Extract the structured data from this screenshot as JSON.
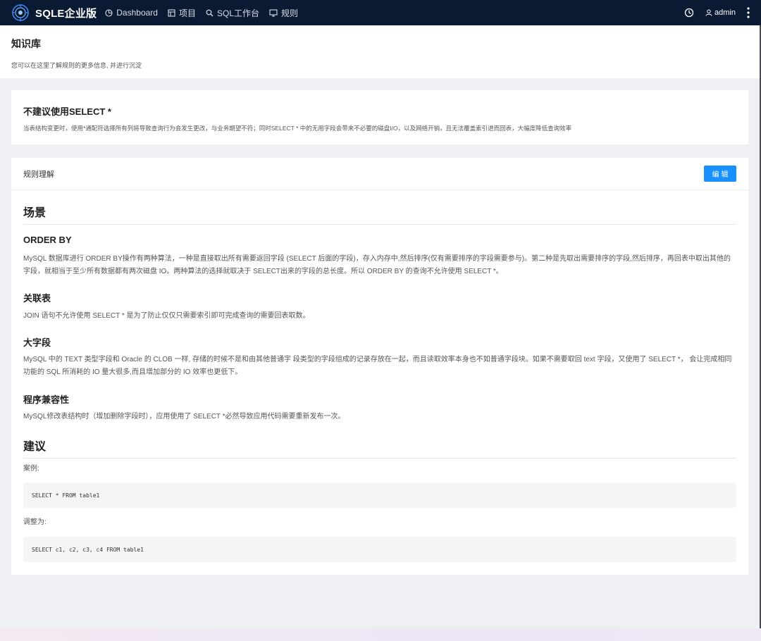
{
  "app": {
    "logo_text": "SQLE企业版",
    "nav": [
      {
        "label": "Dashboard",
        "icon": "dashboard-icon"
      },
      {
        "label": "项目",
        "icon": "project-icon"
      },
      {
        "label": "SQL工作台",
        "icon": "search-icon"
      },
      {
        "label": "规则",
        "icon": "monitor-icon"
      }
    ],
    "user": "admin"
  },
  "page": {
    "title": "知识库",
    "subtitle": "您可以在这里了解规则的更多信息, 并进行沉淀"
  },
  "rule": {
    "title": "不建议使用SELECT *",
    "description": "当表结构变更时，使用*通配符选择所有列将导致查询行为会发生更改，与业务期望不符；同时SELECT * 中的无用字段会带来不必要的磁盘I/O，以及网络开销，且无法覆盖索引进而回表，大幅度降低查询效率"
  },
  "detail": {
    "header_label": "规则理解",
    "edit_label": "编辑",
    "scene_heading": "场景",
    "sections": [
      {
        "heading": "ORDER BY",
        "text": "MySQL 数据库进行 ORDER BY操作有两种算法，一种是直接取出所有需要返回字段 (SELECT 后面的字段)，存入内存中,然后排序(仅有需要排序的字段需要参与)。第二种是先取出需要排序的字段,然后排序，再回表中取出其他的字段，就相当于至少所有数据都有两次磁盘 IO。两种算法的选择就取决于 SELECT出来的字段的总长度。所以 ORDER BY 的查询不允许使用 SELECT *。"
      },
      {
        "heading": "关联表",
        "text": "JOIN 语句不允许使用 SELECT * 是为了防止仅仅只需要索引即可完成查询的需要回表取数。"
      },
      {
        "heading": "大字段",
        "text": "MySQL 中的 TEXT 类型字段和 Oracle 的 CLOB 一样, 存储的时候不是和由其他普通字 段类型的字段组成的记录存放在一起，而且读取效率本身也不如普通字段块。如果不需要取回 text 字段，又使用了 SELECT *， 会让完成相同功能的 SQL 所消耗的 IO 量大很多,而且增加部分的 IO 效率也更低下。"
      },
      {
        "heading": "程序兼容性",
        "text": "MySQL修改表结构时（增加删除字段时），应用使用了 SELECT *必然导致应用代码需要重新发布一次。"
      }
    ],
    "advice_heading": "建议",
    "example_label": "案例:",
    "example_code": "SELECT * FROM table1",
    "adjust_label": "调整为:",
    "adjust_code": "SELECT c1, c2, c3, c4 FROM table1"
  }
}
